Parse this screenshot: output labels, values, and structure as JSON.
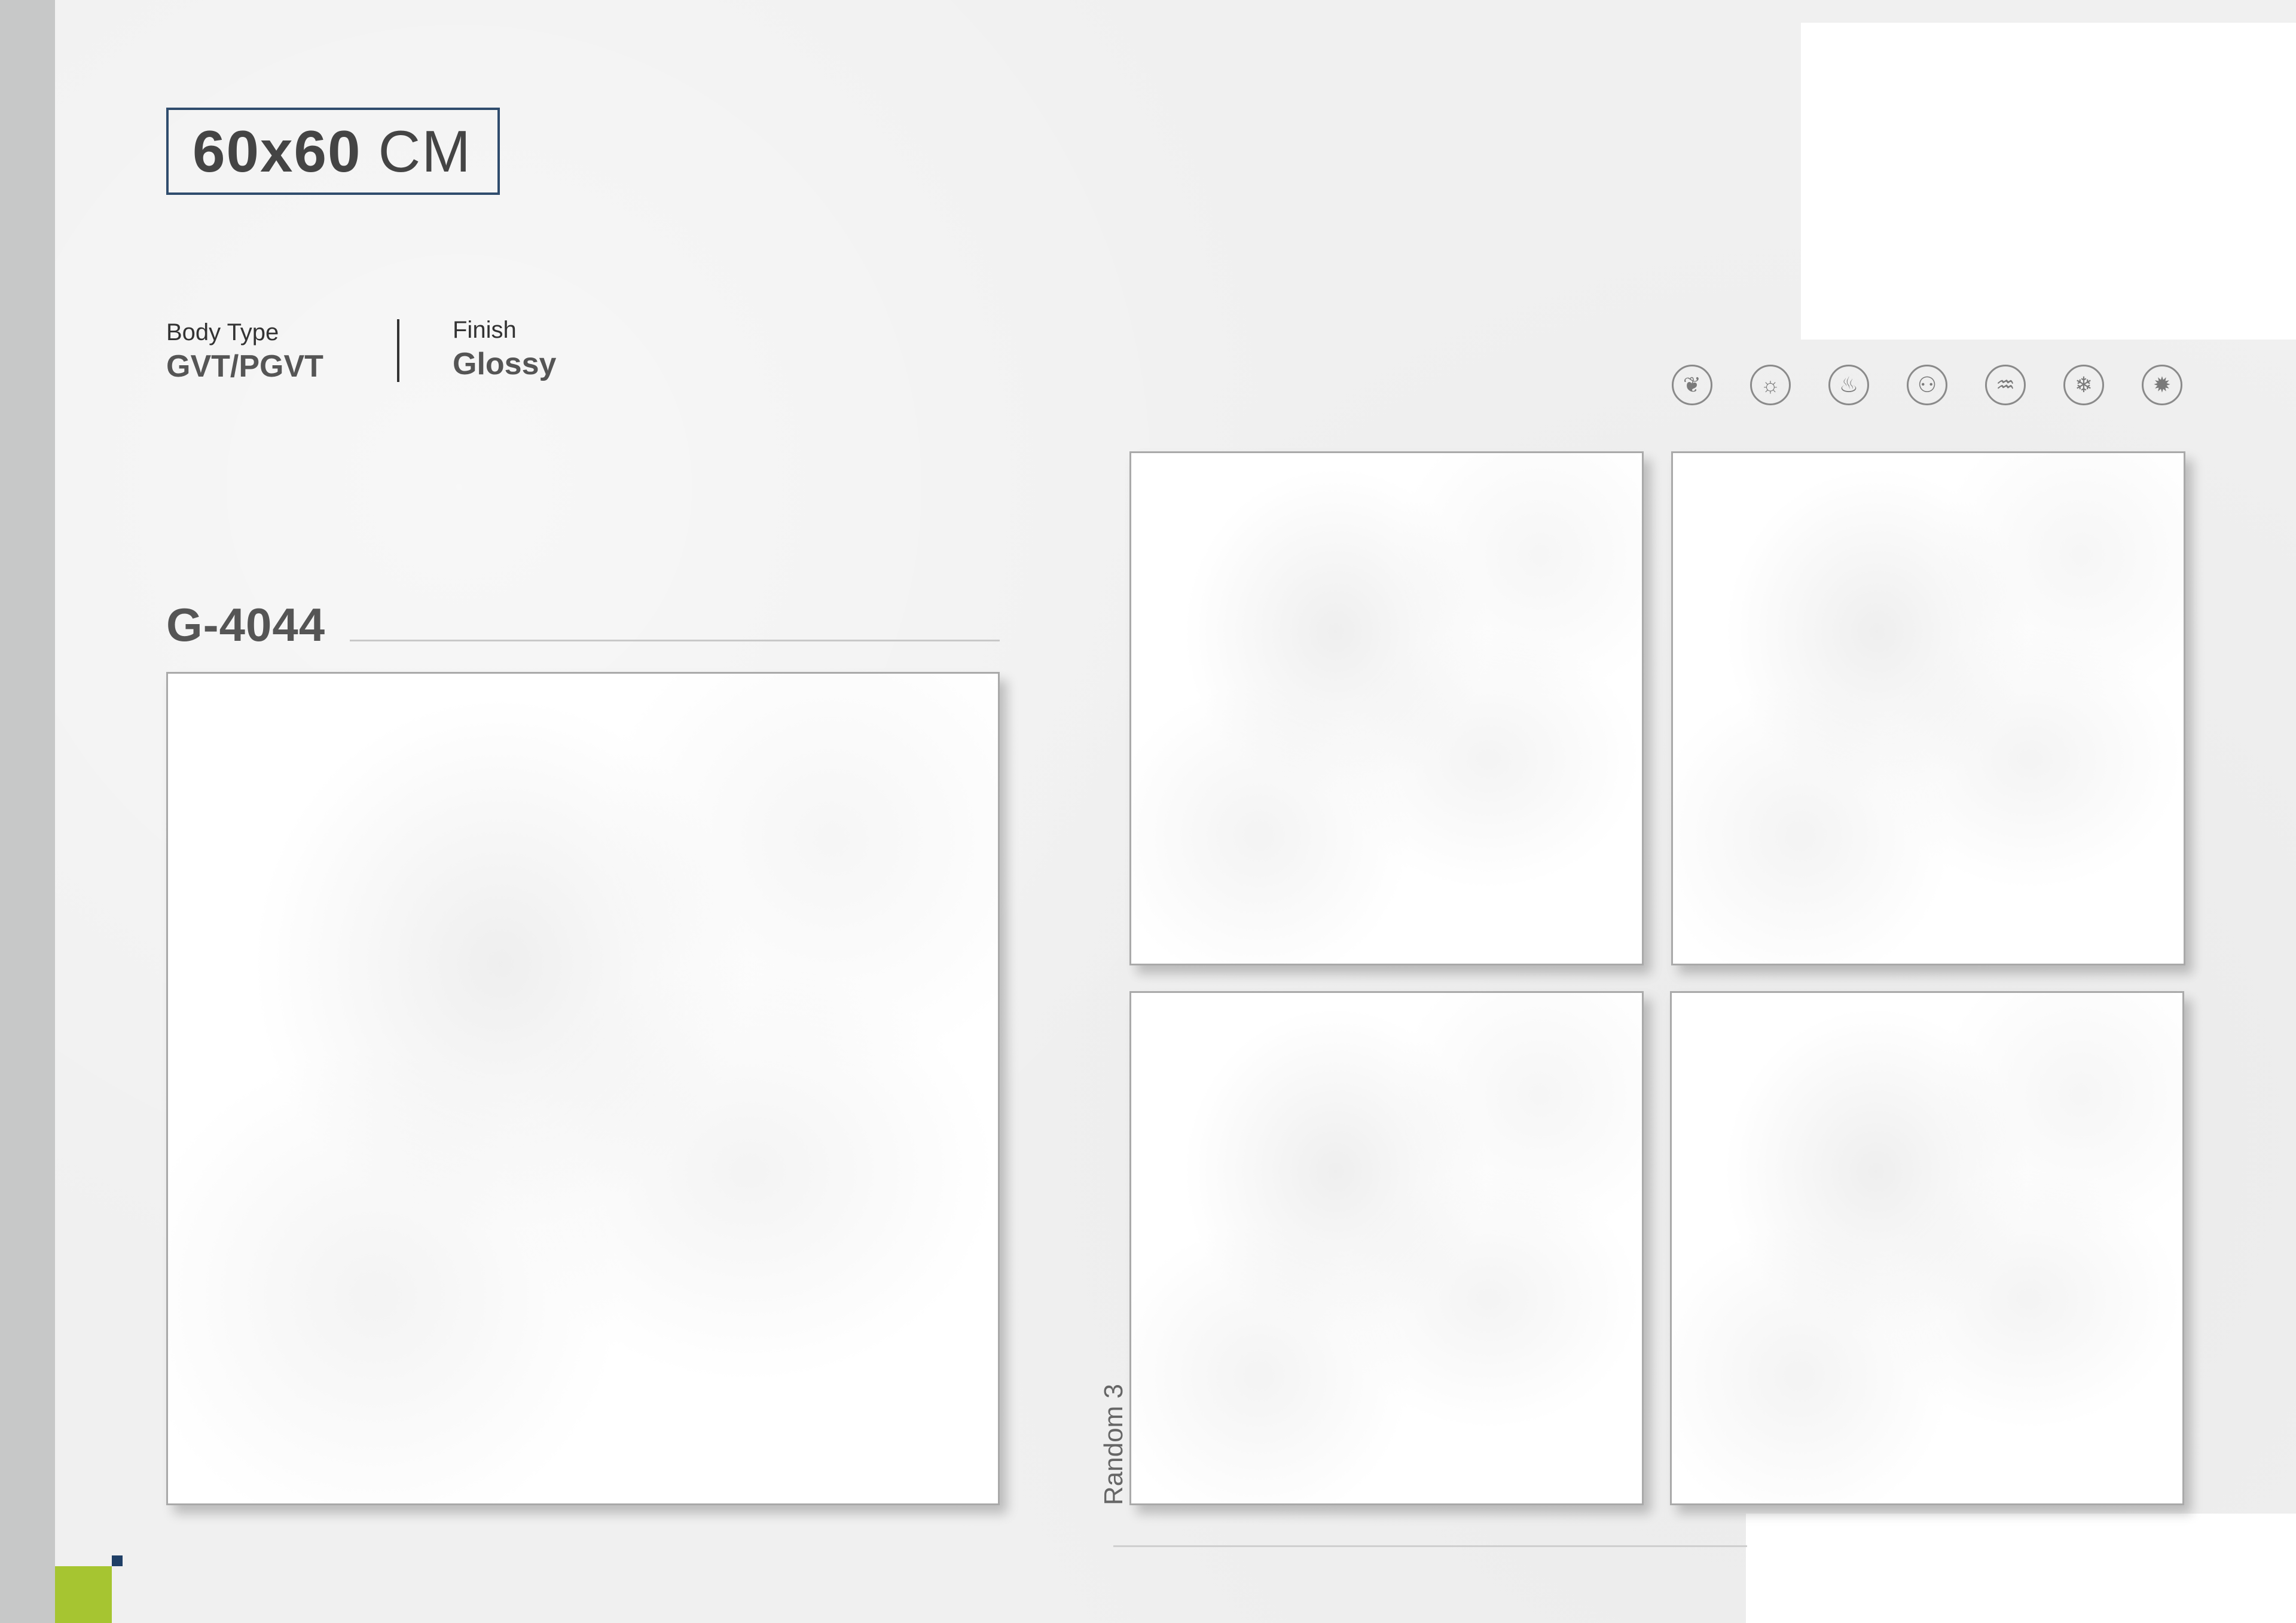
{
  "header": {
    "size_number": "60x60",
    "size_unit": "CM"
  },
  "specs": {
    "body_type_label": "Body Type",
    "body_type_value": "GVT/PGVT",
    "finish_label": "Finish",
    "finish_value": "Glossy"
  },
  "feature_icons": [
    {
      "name": "leaf-icon",
      "glyph": "❦"
    },
    {
      "name": "sun-icon",
      "glyph": "☼"
    },
    {
      "name": "flame-drop-icon",
      "glyph": "♨"
    },
    {
      "name": "people-icon",
      "glyph": "⚇"
    },
    {
      "name": "bath-icon",
      "glyph": "♒"
    },
    {
      "name": "snowflake-icon",
      "glyph": "❄"
    },
    {
      "name": "gear-icon",
      "glyph": "✹"
    }
  ],
  "product": {
    "code": "G-4044"
  },
  "variants": {
    "label": "Random 3"
  },
  "colors": {
    "accent_green": "#a6c531",
    "accent_navy": "#1f3f66",
    "strip_gray": "#c7c8c8"
  }
}
